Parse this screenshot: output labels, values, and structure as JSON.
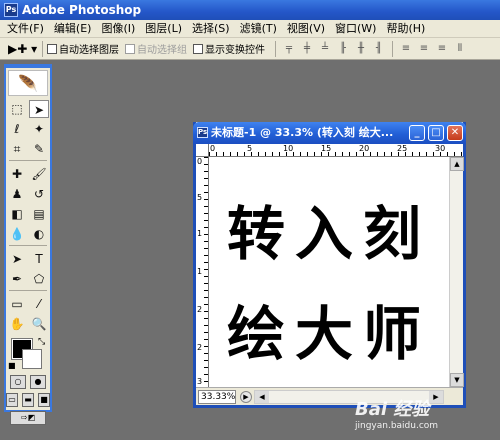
{
  "app": {
    "title": "Adobe Photoshop"
  },
  "menu": [
    "文件(F)",
    "编辑(E)",
    "图像(I)",
    "图层(L)",
    "选择(S)",
    "滤镜(T)",
    "视图(V)",
    "窗口(W)",
    "帮助(H)"
  ],
  "options": {
    "auto_select_layer": "自动选择图层",
    "auto_select_group": "自动选择组",
    "show_transform": "显示变换控件"
  },
  "document": {
    "title": "未标题-1 @ 33.3% (转入刻 绘大...",
    "zoom": "33.33%",
    "line1": "转入刻",
    "line2": "绘大师",
    "ruler_top": [
      "0",
      "5",
      "10",
      "15",
      "20",
      "25",
      "30"
    ],
    "ruler_left": [
      "0",
      "5",
      "1",
      "1",
      "2",
      "2",
      "3"
    ]
  },
  "watermark": {
    "logo": "Bai 经验",
    "url": "jingyan.baidu.com"
  }
}
